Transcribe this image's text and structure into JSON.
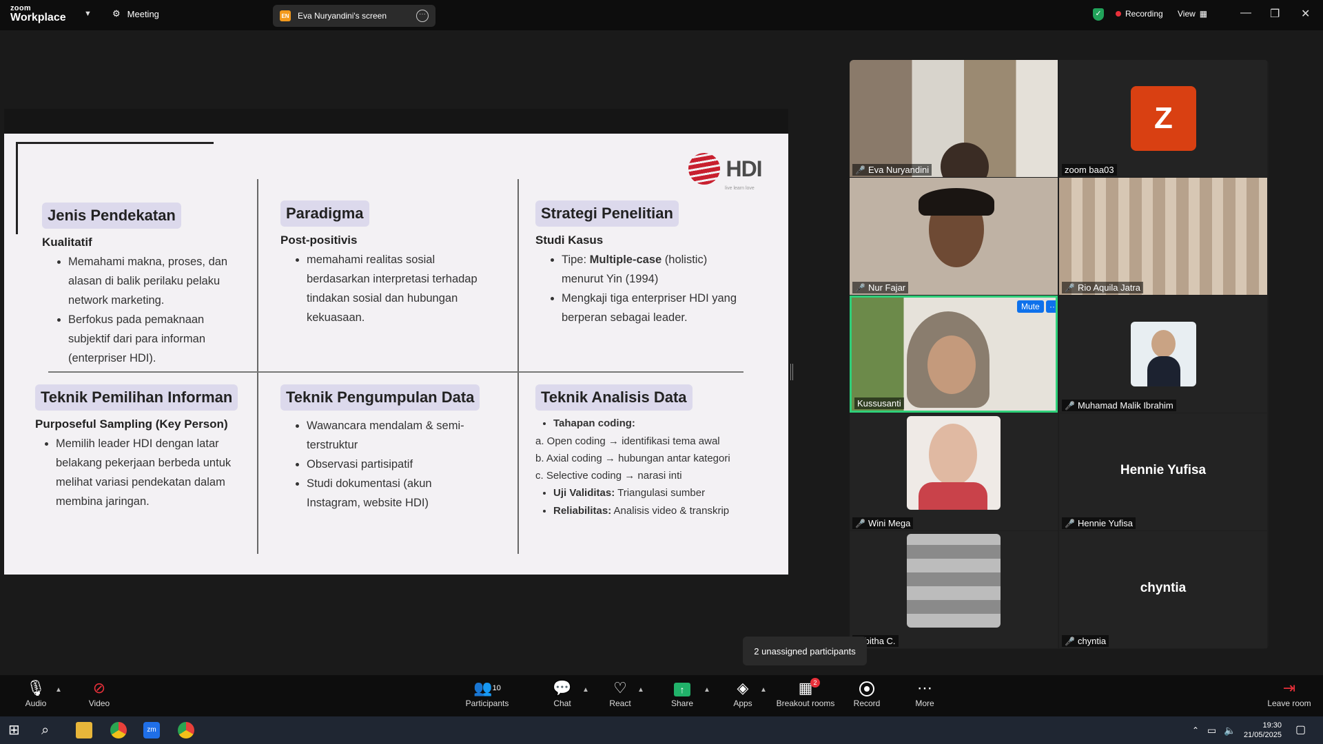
{
  "app": {
    "logo_line1": "zoom",
    "logo_line2": "Workplace",
    "meeting_label": "Meeting",
    "share_badge": "EN",
    "share_title": "Eva Nuryandini's screen",
    "recording_label": "Recording",
    "view_label": "View"
  },
  "slide": {
    "logo_text": "HDI",
    "logo_tagline": "live learn love",
    "sections": {
      "s1": {
        "title": "Jenis Pendekatan",
        "subtitle": "Kualitatif",
        "items": [
          "Memahami makna, proses, dan alasan di balik perilaku pelaku network marketing.",
          "Berfokus pada pemaknaan subjektif dari para informan (enterpriser HDI)."
        ]
      },
      "s2": {
        "title": "Paradigma",
        "subtitle": "Post-positivis",
        "items": [
          "memahami realitas sosial berdasarkan interpretasi terhadap tindakan sosial dan hubungan kekuasaan."
        ]
      },
      "s3": {
        "title": "Strategi Penelitian",
        "subtitle": "Studi Kasus",
        "item1_prefix": "Tipe: ",
        "item1_bold": "Multiple-case",
        "item1_suffix": " (holistic) menurut Yin (1994)",
        "item2": "Mengkaji tiga enterpriser HDI yang berperan sebagai leader."
      },
      "s4": {
        "title": "Teknik Pemilihan Informan",
        "subtitle": "Purposeful Sampling (Key Person)",
        "items": [
          "Memilih leader HDI dengan latar belakang pekerjaan berbeda untuk melihat variasi pendekatan dalam membina jaringan."
        ]
      },
      "s5": {
        "title": "Teknik Pengumpulan Data",
        "items": [
          "Wawancara mendalam & semi-terstruktur",
          "Observasi partisipatif",
          "Studi dokumentasi (akun Instagram, website HDI)"
        ]
      },
      "s6": {
        "title": "Teknik Analisis Data",
        "tahapan": "Tahapan coding:",
        "lines": [
          "a. Open coding → identifikasi tema awal",
          "b. Axial coding → hubungan antar kategori",
          "c. Selective coding → narasi inti"
        ],
        "uji_label": "Uji Validitas:",
        "uji_value": " Triangulasi sumber",
        "rel_label": "Reliabilitas:",
        "rel_value": " Analisis video & transkrip"
      }
    }
  },
  "participants": [
    {
      "name": "Eva Nuryandini",
      "muted": true
    },
    {
      "name": "zoom baa03",
      "initial": "Z",
      "muted": false
    },
    {
      "name": "Nur Fajar",
      "muted": true
    },
    {
      "name": "Rio Aquila Jatra",
      "muted": true
    },
    {
      "name": "Kussusanti",
      "muted": false,
      "mute_button": "Mute",
      "more_button": "···"
    },
    {
      "name": "Muhamad Malik Ibrahim",
      "muted": true
    },
    {
      "name": "Wini Mega",
      "muted": true
    },
    {
      "name": "Hennie Yufisa",
      "muted": true,
      "display": "Hennie Yufisa"
    },
    {
      "name": "Tabitha C.",
      "muted": false
    },
    {
      "name": "chyntia",
      "muted": true,
      "display": "chyntia"
    }
  ],
  "tooltip": "2 unassigned participants",
  "toolbar": {
    "audio": "Audio",
    "video": "Video",
    "participants": "Participants",
    "participants_count": "10",
    "chat": "Chat",
    "react": "React",
    "share": "Share",
    "apps": "Apps",
    "breakout": "Breakout rooms",
    "breakout_badge": "2",
    "record": "Record",
    "more": "More",
    "leave": "Leave room"
  },
  "taskbar": {
    "time": "19:30",
    "date": "21/05/2025"
  }
}
